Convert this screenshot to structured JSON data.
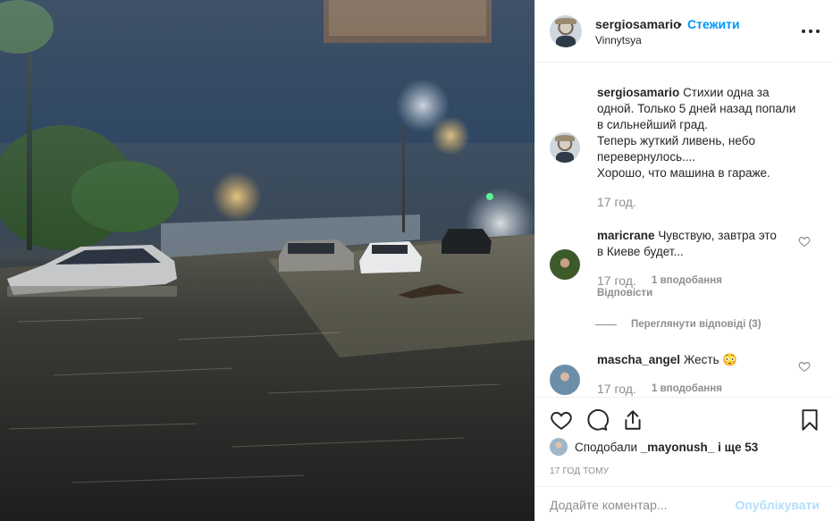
{
  "post": {
    "username": "sergiosamario",
    "separator": "•",
    "follow_label": "Стежити",
    "location": "Vinnytsya"
  },
  "caption": {
    "username": "sergiosamario",
    "lines": [
      "Стихии одна за",
      "одной. Только 5 дней назад попали",
      "в сильнейший град.",
      "Теперь жуткий ливень, небо",
      "перевернулось....",
      "Хорошо, что машина в гараже."
    ],
    "time": "17 год."
  },
  "comments": [
    {
      "username": "maricrane",
      "text_lines": [
        "Чувствую, завтра это",
        "в Киеве будет..."
      ],
      "time": "17 год.",
      "likes": "1 вподобання",
      "reply_label": "Відповісти"
    },
    {
      "username": "mascha_angel",
      "text": "Жесть",
      "emoji": "😳",
      "time": "17 год.",
      "likes": "1 вподобання"
    }
  ],
  "view_replies_label": "Переглянути відповіді (3)",
  "likes": {
    "prefix": "Сподобали",
    "user": "_mayonush_",
    "suffix": "і ще 53"
  },
  "post_time": "17 год тому",
  "add_comment": {
    "placeholder": "Додайте коментар...",
    "post_label": "Опублікувати"
  },
  "colors": {
    "link_blue": "#0095f6",
    "muted": "#8e8e8e",
    "post_disabled": "#b2dffc"
  },
  "icons": [
    "heart-icon",
    "comment-icon",
    "share-icon",
    "bookmark-icon",
    "more-icon"
  ]
}
